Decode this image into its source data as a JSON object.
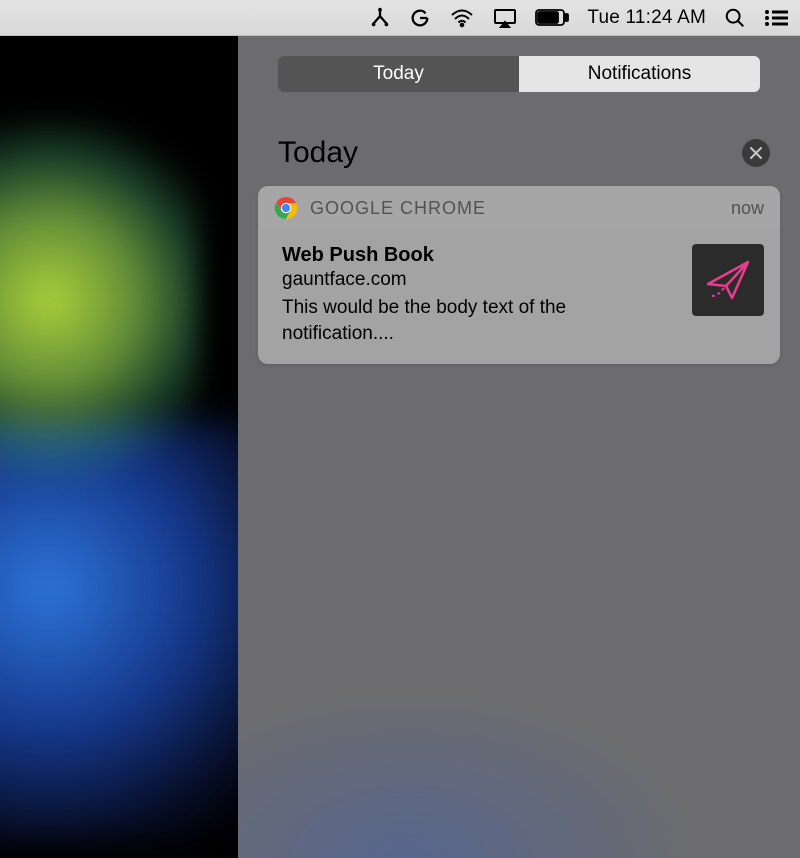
{
  "menubar": {
    "time": "Tue 11:24 AM"
  },
  "nc": {
    "toggle": {
      "today": "Today",
      "notifications": "Notifications"
    },
    "section_title": "Today"
  },
  "notification": {
    "app_name": "GOOGLE CHROME",
    "timestamp": "now",
    "title": "Web Push Book",
    "domain": "gauntface.com",
    "body": "This would be the body text of the notification...."
  }
}
